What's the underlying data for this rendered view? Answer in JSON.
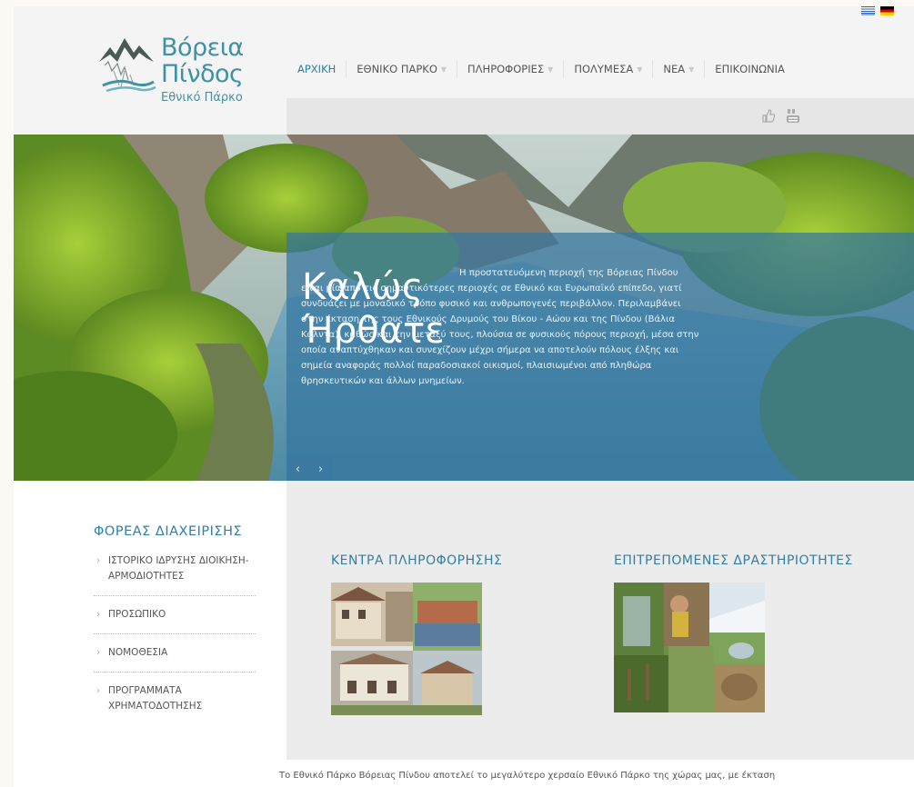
{
  "logo": {
    "line1": "Βόρεια",
    "line2": "Πίνδος",
    "line3": "Εθνικό Πάρκο"
  },
  "languages": [
    {
      "name": "greek-flag",
      "code": "el"
    },
    {
      "name": "german-flag",
      "code": "de"
    }
  ],
  "nav": [
    {
      "label": "ΑΡΧΙΚΗ",
      "active": true,
      "dropdown": false
    },
    {
      "label": "ΕΘΝΙΚΟ ΠΑΡΚΟ",
      "active": false,
      "dropdown": true
    },
    {
      "label": "ΠΛΗΡΟΦΟΡΙΕΣ",
      "active": false,
      "dropdown": true
    },
    {
      "label": "ΠΟΛΥΜΕΣΑ",
      "active": false,
      "dropdown": true
    },
    {
      "label": "ΝΕΑ",
      "active": false,
      "dropdown": true
    },
    {
      "label": "ΕΠΙΚΟΙΝΩΝΙΑ",
      "active": false,
      "dropdown": false
    }
  ],
  "social": [
    "like-icon",
    "youtube-icon"
  ],
  "hero": {
    "title": "Καλώς Ήρθατε",
    "text": "Η προστατευόμενη περιοχή της Βόρειας Πίνδου είναι μία από τις σημαντικότερες περιοχές σε Εθνικό και Ευρωπαϊκό επίπεδο, γιατί συνδυάζει με μοναδικό τρόπο φυσικό και ανθρωπογενές περιβάλλον. Περιλαμβάνει στην έκταση της τους Εθνικούς Δρυμούς του Βίκου - Αώου και της Πίνδου (Βάλια Κάλντα), καθώς και την μεταξύ τους, πλούσια σε φυσικούς πόρους περιοχή, μέσα στην οποία αναπτύχθηκαν και συνεχίζουν μέχρι σήμερα να αποτελούν πόλους έλξης και σημεία αναφοράς πολλοί παραδοσιακοί οικισμοί, πλαισιωμένοι από πληθώρα θρησκευτικών και άλλων μνημείων.",
    "prev": "‹",
    "next": "›"
  },
  "sidebar": {
    "title": "ΦΟΡΕΑΣ ΔΙΑΧΕΙΡΙΣΗΣ",
    "items": [
      {
        "label": "ΙΣΤΟΡΙΚΟ ΙΔΡΥΣΗΣ ΔΙΟΙΚΗΣΗ-ΑΡΜΟΔΙΟΤΗΤΕΣ"
      },
      {
        "label": "ΠΡΟΣΩΠΙΚΟ"
      },
      {
        "label": "ΝΟΜΟΘΕΣΙΑ"
      },
      {
        "label": "ΠΡΟΓΡΑΜΜΑΤΑ ΧΡΗΜΑΤΟΔΟΤΗΣΗΣ"
      }
    ]
  },
  "columns": {
    "info_centers": "ΚΕΝΤΡΑ ΠΛΗΡΟΦΟΡΗΣΗΣ",
    "activities": "ΕΠΙΤΡΕΠΟΜΕΝΕΣ ΔΡΑΣΤΗΡΙΟΤΗΤΕΣ"
  },
  "intro_text": "Το Εθνικό Πάρκο Βόρειας Πίνδου αποτελεί το μεγαλύτερο χερσαίο Εθνικό Πάρκο της χώρας μας, με έκταση",
  "colors": {
    "accent": "#2f7fa6",
    "hero_overlay": "#3576a0",
    "logo": "#3f91a4"
  }
}
